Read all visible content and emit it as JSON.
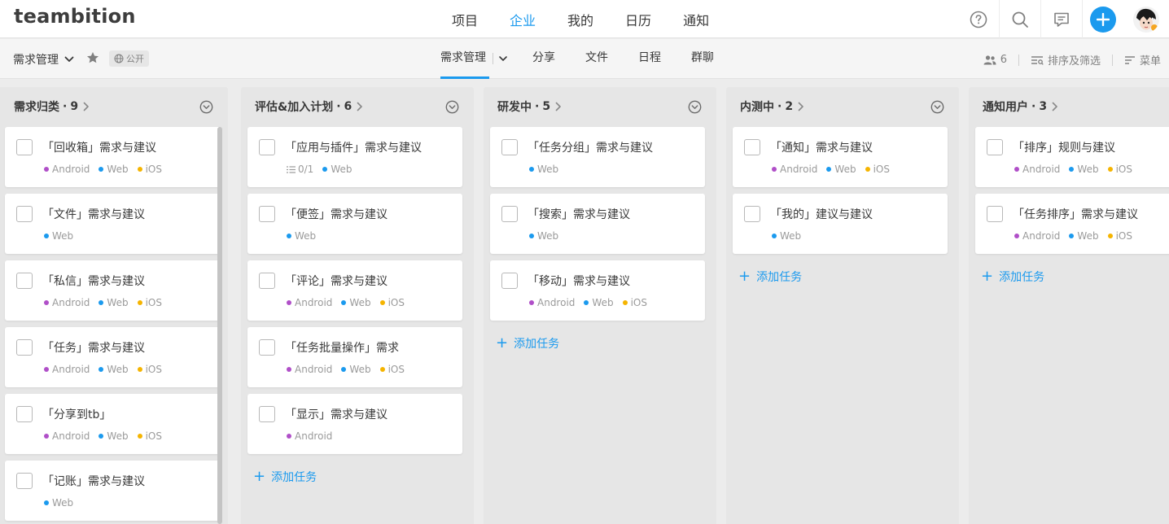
{
  "app": {
    "logo": "teambition"
  },
  "nav": {
    "items": [
      "项目",
      "企业",
      "我的",
      "日历",
      "通知"
    ],
    "active_index": 1
  },
  "subbar": {
    "project_title": "需求管理",
    "public_label": "公开",
    "tabs": [
      "需求管理",
      "分享",
      "文件",
      "日程",
      "群聊"
    ],
    "member_count": "6",
    "sort_filter_label": "排序及筛选",
    "menu_label": "菜单"
  },
  "colors": {
    "accent": "#1b9aee",
    "android": "#b04fc8",
    "web": "#1b9aee",
    "ios": "#f5b400"
  },
  "add_task_label": "添加任务",
  "columns": [
    {
      "title": "需求归类",
      "count": "9",
      "cards": [
        {
          "title": "「回收箱」需求与建议",
          "tags": [
            "Android",
            "Web",
            "iOS"
          ]
        },
        {
          "title": "「文件」需求与建议",
          "tags": [
            "Web"
          ]
        },
        {
          "title": "「私信」需求与建议",
          "tags": [
            "Android",
            "Web",
            "iOS"
          ]
        },
        {
          "title": "「任务」需求与建议",
          "tags": [
            "Android",
            "Web",
            "iOS"
          ]
        },
        {
          "title": "「分享到tb」",
          "tags": [
            "Android",
            "Web",
            "iOS"
          ]
        },
        {
          "title": "「记账」需求与建议",
          "tags": [
            "Web"
          ]
        }
      ]
    },
    {
      "title": "评估&加入计划",
      "count": "6",
      "cards": [
        {
          "title": "「应用与插件」需求与建议",
          "subtask": "0/1",
          "tags": [
            "Web"
          ]
        },
        {
          "title": "「便签」需求与建议",
          "tags": [
            "Web"
          ]
        },
        {
          "title": "「评论」需求与建议",
          "tags": [
            "Android",
            "Web",
            "iOS"
          ]
        },
        {
          "title": "「任务批量操作」需求",
          "tags": [
            "Android",
            "Web",
            "iOS"
          ]
        },
        {
          "title": "「显示」需求与建议",
          "tags": [
            "Android"
          ]
        }
      ]
    },
    {
      "title": "研发中",
      "count": "5",
      "cards": [
        {
          "title": "「任务分组」需求与建议",
          "tags": [
            "Web"
          ]
        },
        {
          "title": "「搜索」需求与建议",
          "tags": [
            "Web"
          ]
        },
        {
          "title": "「移动」需求与建议",
          "tags": [
            "Android",
            "Web",
            "iOS"
          ]
        }
      ]
    },
    {
      "title": "内测中",
      "count": "2",
      "cards": [
        {
          "title": "「通知」需求与建议",
          "tags": [
            "Android",
            "Web",
            "iOS"
          ]
        },
        {
          "title": "「我的」建议与建议",
          "tags": [
            "Web"
          ]
        }
      ]
    },
    {
      "title": "通知用户",
      "count": "3",
      "cards": [
        {
          "title": "「排序」规则与建议",
          "tags": [
            "Android",
            "Web",
            "iOS"
          ]
        },
        {
          "title": "「任务排序」需求与建议",
          "tags": [
            "Android",
            "Web",
            "iOS"
          ]
        }
      ]
    }
  ]
}
